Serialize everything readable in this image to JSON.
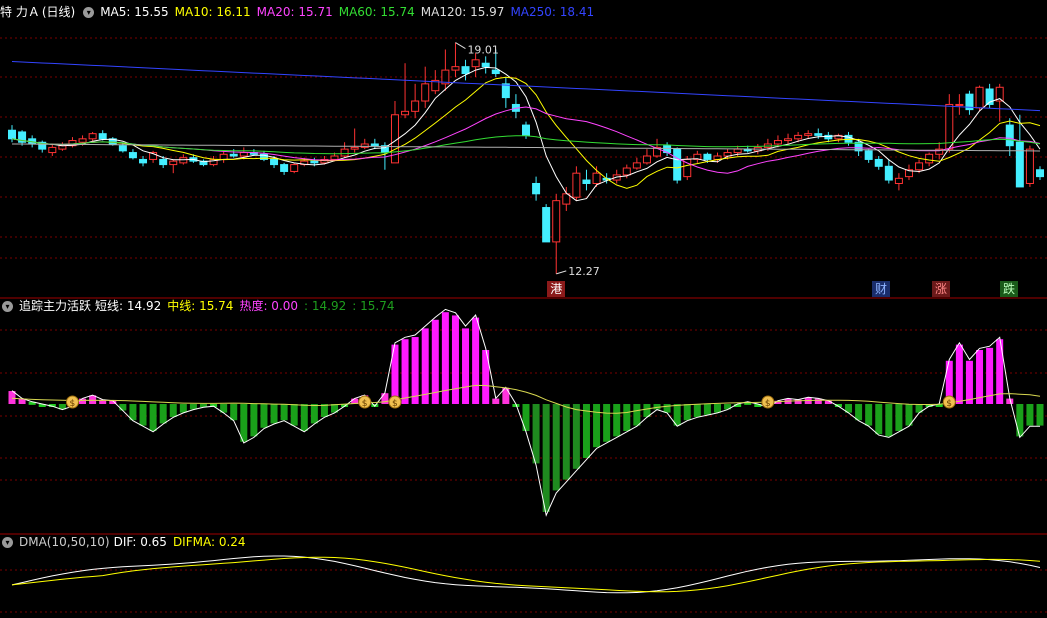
{
  "main_panel": {
    "stock_name": "特 力Ａ",
    "period": "(日线)",
    "ma": [
      {
        "label": "MA5:",
        "value": "15.55",
        "color": "#ffffff"
      },
      {
        "label": "MA10:",
        "value": "16.11",
        "color": "#ffff00"
      },
      {
        "label": "MA20:",
        "value": "15.71",
        "color": "#ff44ff"
      },
      {
        "label": "MA60:",
        "value": "15.74",
        "color": "#33dd33"
      },
      {
        "label": "MA120:",
        "value": "15.97",
        "color": "#dddddd"
      },
      {
        "label": "MA250:",
        "value": "18.41",
        "color": "#3344ff"
      }
    ],
    "high_label": "19.01",
    "low_label": "12.27",
    "markers": [
      {
        "text": "港",
        "bg": "#8b1a1a",
        "color": "#ffffff"
      },
      {
        "text": "财",
        "bg": "#1a2d6b",
        "color": "#8fb4ff"
      },
      {
        "text": "涨",
        "bg": "#6b1a1a",
        "color": "#ff8888"
      },
      {
        "text": "跌",
        "bg": "#1a5b1a",
        "color": "#bbffbb"
      }
    ]
  },
  "indicator_panel": {
    "name": "追踪主力活跃",
    "items": [
      {
        "label": "短线:",
        "value": "14.92",
        "color": "#ffffff"
      },
      {
        "label": "中线:",
        "value": "15.74",
        "color": "#ffff00"
      },
      {
        "label": "热度:",
        "value": "0.00",
        "color": "#ff44ff"
      },
      {
        "label": ":",
        "value": "14.92",
        "color": "#1e9e1e"
      },
      {
        "label": ":",
        "value": "15.74",
        "color": "#1e9e1e"
      }
    ]
  },
  "dma_panel": {
    "name": "DMA(10,50,10)",
    "items": [
      {
        "label": "DIF:",
        "value": "0.65",
        "color": "#ffffff"
      },
      {
        "label": "DIFMA:",
        "value": "0.24",
        "color": "#ffff00"
      }
    ]
  },
  "colors": {
    "up": "#ff3333",
    "down": "#44eeff",
    "grid": "#7a0000",
    "divider": "#a00000"
  },
  "chart_data": [
    {
      "type": "candlestick",
      "title": "特 力Ａ (日线)",
      "ylim": [
        11.8,
        19.6
      ],
      "series_names": [
        "MA5",
        "MA10",
        "MA20",
        "MA60",
        "MA120",
        "MA250"
      ],
      "candles": [
        [
          16.45,
          16.2,
          16.6,
          16.1
        ],
        [
          16.4,
          16.1,
          16.45,
          16.0
        ],
        [
          16.2,
          16.05,
          16.3,
          15.95
        ],
        [
          16.1,
          15.9,
          16.15,
          15.8
        ],
        [
          15.8,
          15.95,
          16.05,
          15.7
        ],
        [
          15.9,
          16.0,
          16.1,
          15.85
        ],
        [
          16.0,
          16.15,
          16.25,
          15.95
        ],
        [
          16.1,
          16.2,
          16.3,
          16.0
        ],
        [
          16.2,
          16.35,
          16.4,
          16.1
        ],
        [
          16.35,
          16.2,
          16.45,
          16.15
        ],
        [
          16.2,
          16.05,
          16.25,
          16.0
        ],
        [
          16.0,
          15.85,
          16.1,
          15.8
        ],
        [
          15.8,
          15.65,
          15.9,
          15.6
        ],
        [
          15.6,
          15.5,
          15.7,
          15.4
        ],
        [
          15.6,
          15.8,
          15.85,
          15.5
        ],
        [
          15.6,
          15.45,
          15.7,
          15.35
        ],
        [
          15.45,
          15.55,
          15.6,
          15.2
        ],
        [
          15.5,
          15.65,
          15.75,
          15.45
        ],
        [
          15.65,
          15.55,
          15.75,
          15.5
        ],
        [
          15.55,
          15.45,
          15.6,
          15.4
        ],
        [
          15.45,
          15.6,
          15.7,
          15.4
        ],
        [
          15.6,
          15.75,
          15.85,
          15.5
        ],
        [
          15.75,
          15.7,
          15.9,
          15.65
        ],
        [
          15.7,
          15.8,
          15.95,
          15.6
        ],
        [
          15.8,
          15.75,
          15.9,
          15.7
        ],
        [
          15.75,
          15.6,
          15.85,
          15.55
        ],
        [
          15.6,
          15.45,
          15.7,
          15.35
        ],
        [
          15.45,
          15.25,
          15.5,
          15.15
        ],
        [
          15.25,
          15.45,
          15.5,
          15.2
        ],
        [
          15.45,
          15.55,
          15.65,
          15.4
        ],
        [
          15.55,
          15.5,
          15.65,
          15.4
        ],
        [
          15.5,
          15.6,
          15.7,
          15.45
        ],
        [
          15.6,
          15.7,
          15.8,
          15.55
        ],
        [
          15.7,
          15.9,
          16.1,
          15.65
        ],
        [
          15.9,
          15.95,
          16.5,
          15.8
        ],
        [
          15.95,
          16.05,
          16.2,
          15.9
        ],
        [
          16.05,
          16.0,
          16.2,
          15.9
        ],
        [
          16.0,
          15.8,
          16.1,
          15.3
        ],
        [
          15.5,
          16.9,
          17.3,
          15.5
        ],
        [
          16.9,
          17.0,
          18.4,
          16.8
        ],
        [
          17.0,
          17.3,
          17.8,
          16.8
        ],
        [
          17.3,
          17.8,
          18.3,
          17.1
        ],
        [
          17.6,
          17.9,
          18.2,
          17.5
        ],
        [
          17.8,
          18.2,
          18.8,
          17.6
        ],
        [
          18.2,
          18.3,
          19.0,
          18.0
        ],
        [
          18.3,
          18.1,
          18.5,
          17.9
        ],
        [
          18.3,
          18.5,
          18.7,
          18.0
        ],
        [
          18.4,
          18.3,
          18.6,
          18.1
        ],
        [
          18.2,
          18.1,
          18.8,
          18.0
        ],
        [
          17.8,
          17.4,
          18.0,
          17.1
        ],
        [
          17.2,
          17.0,
          17.5,
          16.8
        ],
        [
          16.6,
          16.3,
          16.7,
          16.2
        ],
        [
          14.9,
          14.6,
          15.1,
          14.4
        ],
        [
          14.2,
          13.2,
          14.3,
          13.2
        ],
        [
          13.2,
          14.4,
          14.6,
          12.27
        ],
        [
          14.3,
          14.6,
          14.8,
          14.1
        ],
        [
          14.5,
          15.2,
          15.4,
          14.4
        ],
        [
          15.0,
          14.9,
          15.3,
          14.7
        ],
        [
          14.9,
          15.2,
          15.4,
          14.8
        ],
        [
          15.05,
          15.0,
          15.2,
          14.9
        ],
        [
          15.0,
          15.15,
          15.3,
          14.9
        ],
        [
          15.15,
          15.35,
          15.45,
          15.05
        ],
        [
          15.35,
          15.5,
          15.65,
          15.3
        ],
        [
          15.5,
          15.7,
          15.9,
          15.45
        ],
        [
          15.7,
          15.95,
          16.2,
          15.65
        ],
        [
          16.0,
          15.8,
          16.1,
          15.7
        ],
        [
          15.9,
          15.0,
          15.95,
          14.9
        ],
        [
          15.1,
          15.6,
          15.7,
          15.0
        ],
        [
          15.6,
          15.75,
          15.85,
          15.5
        ],
        [
          15.75,
          15.6,
          15.8,
          15.5
        ],
        [
          15.6,
          15.7,
          15.8,
          15.5
        ],
        [
          15.7,
          15.8,
          15.9,
          15.6
        ],
        [
          15.8,
          15.9,
          16.0,
          15.7
        ],
        [
          15.9,
          15.85,
          16.0,
          15.8
        ],
        [
          15.85,
          15.95,
          16.05,
          15.75
        ],
        [
          15.95,
          16.05,
          16.2,
          15.85
        ],
        [
          16.05,
          16.15,
          16.3,
          15.95
        ],
        [
          16.15,
          16.2,
          16.35,
          16.05
        ],
        [
          16.2,
          16.3,
          16.4,
          16.1
        ],
        [
          16.3,
          16.35,
          16.45,
          16.2
        ],
        [
          16.35,
          16.3,
          16.5,
          16.2
        ],
        [
          16.3,
          16.2,
          16.4,
          16.1
        ],
        [
          16.2,
          16.3,
          16.35,
          16.1
        ],
        [
          16.3,
          16.1,
          16.4,
          16.0
        ],
        [
          16.1,
          15.85,
          16.2,
          15.7
        ],
        [
          15.85,
          15.6,
          15.9,
          15.5
        ],
        [
          15.6,
          15.4,
          15.7,
          15.3
        ],
        [
          15.4,
          15.0,
          15.6,
          14.9
        ],
        [
          14.9,
          15.05,
          15.2,
          14.7
        ],
        [
          15.1,
          15.3,
          15.45,
          15.0
        ],
        [
          15.3,
          15.5,
          15.6,
          15.2
        ],
        [
          15.5,
          15.75,
          15.8,
          15.4
        ],
        [
          15.75,
          15.9,
          16.1,
          15.6
        ],
        [
          15.9,
          17.2,
          17.5,
          15.8
        ],
        [
          17.2,
          17.2,
          17.5,
          16.9
        ],
        [
          17.5,
          17.05,
          17.6,
          16.9
        ],
        [
          17.1,
          17.7,
          17.75,
          17.0
        ],
        [
          17.65,
          17.2,
          17.8,
          17.1
        ],
        [
          17.3,
          17.7,
          17.8,
          16.7
        ],
        [
          16.6,
          16.0,
          16.8,
          15.7
        ],
        [
          16.1,
          14.8,
          16.9,
          14.8
        ],
        [
          14.9,
          15.9,
          16.0,
          14.8
        ],
        [
          15.3,
          15.1,
          15.4,
          15.0
        ]
      ]
    },
    {
      "type": "bar",
      "title": "追踪主力活跃",
      "ylim": [
        -1,
        1
      ],
      "series": [
        {
          "name": "热度",
          "values": [
            0.12,
            0.05,
            0.02,
            0.0,
            -0.02,
            -0.05,
            -0.02,
            0.05,
            0.08,
            0.04,
            0.03,
            -0.06,
            -0.15,
            -0.2,
            -0.25,
            -0.18,
            -0.12,
            -0.08,
            -0.05,
            -0.03,
            -0.02,
            -0.08,
            -0.15,
            -0.35,
            -0.3,
            -0.22,
            -0.18,
            -0.15,
            -0.2,
            -0.25,
            -0.18,
            -0.12,
            -0.08,
            -0.02,
            0.05,
            0.08,
            -0.02,
            0.1,
            0.55,
            0.6,
            0.62,
            0.7,
            0.78,
            0.85,
            0.82,
            0.7,
            0.8,
            0.5,
            0.05,
            0.15,
            0.0,
            -0.25,
            -0.55,
            -1.0,
            -0.8,
            -0.7,
            -0.6,
            -0.5,
            -0.4,
            -0.35,
            -0.3,
            -0.25,
            -0.2,
            -0.12,
            -0.05,
            -0.08,
            -0.2,
            -0.15,
            -0.12,
            -0.1,
            -0.08,
            -0.05,
            0.0,
            0.02,
            0.0,
            -0.03,
            0.03,
            0.05,
            0.04,
            0.06,
            0.05,
            0.03,
            -0.02,
            -0.08,
            -0.15,
            -0.2,
            -0.28,
            -0.3,
            -0.25,
            -0.2,
            -0.08,
            -0.02,
            0.0,
            0.4,
            0.55,
            0.4,
            0.5,
            0.52,
            0.6,
            0.05,
            -0.3,
            -0.2,
            -0.2
          ]
        }
      ]
    },
    {
      "type": "line",
      "title": "DMA(10,50,10)",
      "series": [
        {
          "name": "DIF"
        },
        {
          "name": "DIFMA"
        }
      ]
    }
  ]
}
